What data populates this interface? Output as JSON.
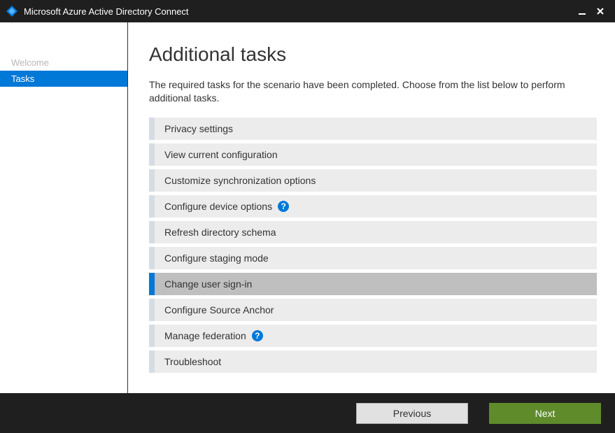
{
  "window": {
    "title": "Microsoft Azure Active Directory Connect"
  },
  "sidebar": {
    "items": [
      {
        "label": "Welcome",
        "state": "disabled"
      },
      {
        "label": "Tasks",
        "state": "active"
      }
    ]
  },
  "main": {
    "title": "Additional tasks",
    "description": "The required tasks for the scenario have been completed. Choose from the list below to perform additional tasks.",
    "tasks": [
      {
        "label": "Privacy settings",
        "help": false,
        "selected": false
      },
      {
        "label": "View current configuration",
        "help": false,
        "selected": false
      },
      {
        "label": "Customize synchronization options",
        "help": false,
        "selected": false
      },
      {
        "label": "Configure device options",
        "help": true,
        "selected": false
      },
      {
        "label": "Refresh directory schema",
        "help": false,
        "selected": false
      },
      {
        "label": "Configure staging mode",
        "help": false,
        "selected": false
      },
      {
        "label": "Change user sign-in",
        "help": false,
        "selected": true
      },
      {
        "label": "Configure Source Anchor",
        "help": false,
        "selected": false
      },
      {
        "label": "Manage federation",
        "help": true,
        "selected": false
      },
      {
        "label": "Troubleshoot",
        "help": false,
        "selected": false
      }
    ]
  },
  "footer": {
    "previous": "Previous",
    "next": "Next"
  }
}
